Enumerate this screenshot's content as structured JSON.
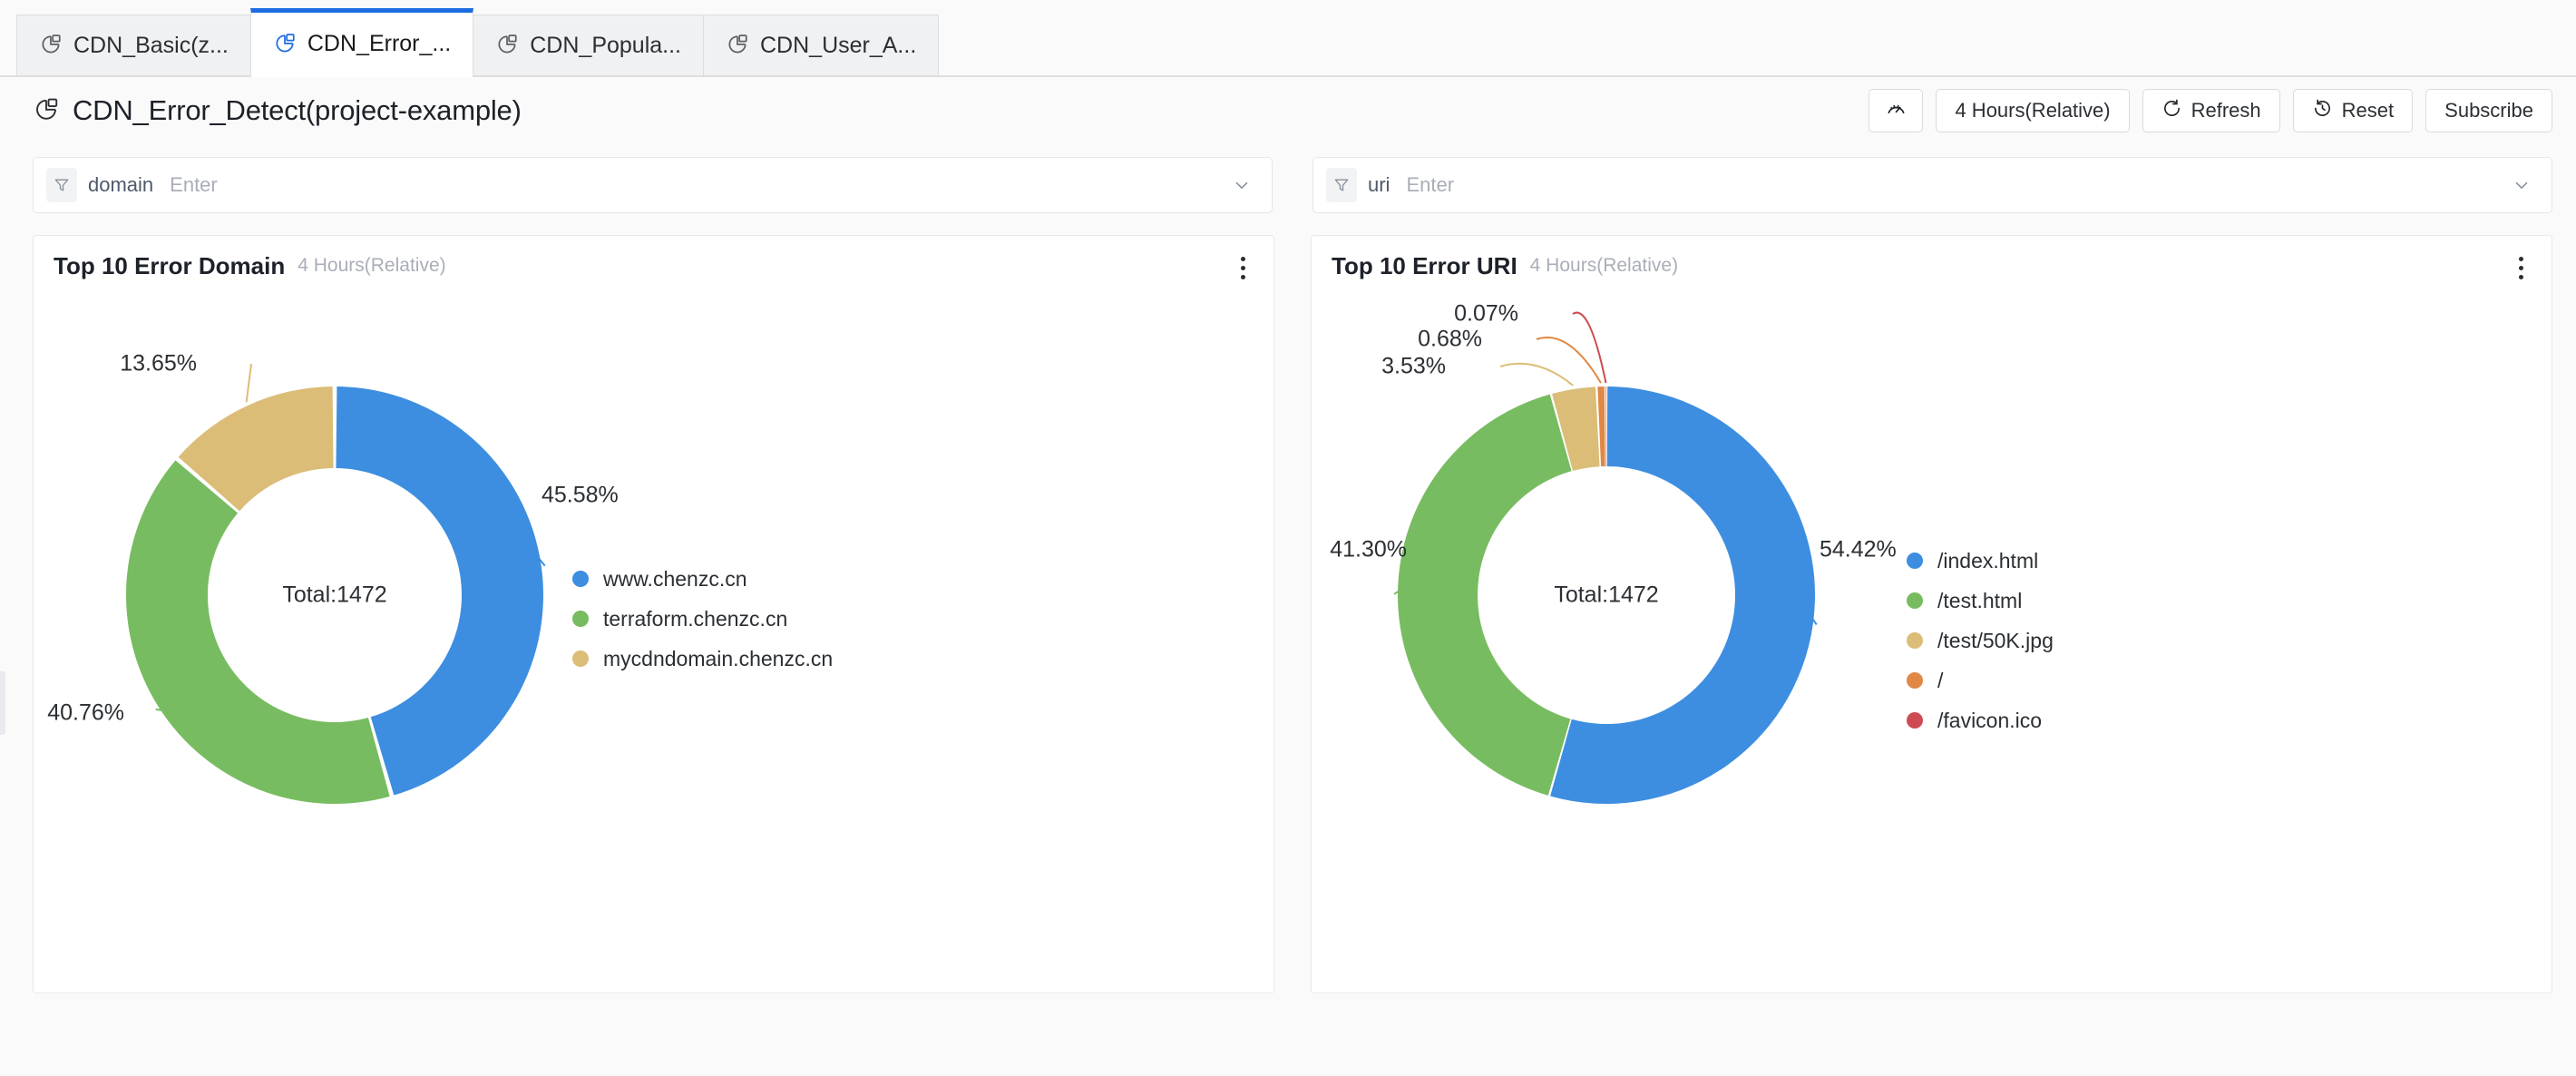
{
  "tabs": [
    {
      "label": "CDN_Basic(z...",
      "icon": "dashboard-icon",
      "active": false
    },
    {
      "label": "CDN_Error_...",
      "icon": "dashboard-icon",
      "active": true
    },
    {
      "label": "CDN_Popula...",
      "icon": "dashboard-icon",
      "active": false
    },
    {
      "label": "CDN_User_A...",
      "icon": "dashboard-icon",
      "active": false
    }
  ],
  "header": {
    "icon": "dashboard-icon",
    "title": "CDN_Error_Detect(project-example)",
    "actions": {
      "gauge_label": "",
      "time_range": "4 Hours(Relative)",
      "refresh": "Refresh",
      "reset": "Reset",
      "subscribe": "Subscribe"
    }
  },
  "filters": [
    {
      "key": "domain",
      "placeholder": "Enter",
      "value": ""
    },
    {
      "key": "uri",
      "placeholder": "Enter",
      "value": ""
    }
  ],
  "colors": {
    "blue": "#3d8ee0",
    "green": "#78bc61",
    "tan": "#dbbd78",
    "orange": "#e08844",
    "red": "#cf4b53",
    "accent": "#1c6ce1",
    "text": "#1d2129",
    "muted": "#a9aeb8"
  },
  "cards": [
    {
      "title": "Top 10 Error Domain",
      "subtitle": "4 Hours(Relative)",
      "total_label": "Total:1472"
    },
    {
      "title": "Top 10 Error URI",
      "subtitle": "4 Hours(Relative)",
      "total_label": "Total:1472"
    }
  ],
  "chart_data": [
    {
      "type": "pie",
      "title": "Top 10 Error Domain",
      "subtitle": "4 Hours(Relative)",
      "total": 1472,
      "total_label": "Total:1472",
      "legend_position": "right",
      "categories": [
        "www.chenzc.cn",
        "terraform.chenzc.cn",
        "mycdndomain.chenzc.cn"
      ],
      "values": [
        45.58,
        40.76,
        13.65
      ],
      "value_labels": [
        "45.58%",
        "40.76%",
        "13.65%"
      ],
      "colors": [
        "#3d8ee0",
        "#78bc61",
        "#dbbd78"
      ]
    },
    {
      "type": "pie",
      "title": "Top 10 Error URI",
      "subtitle": "4 Hours(Relative)",
      "total": 1472,
      "total_label": "Total:1472",
      "legend_position": "right",
      "categories": [
        "/index.html",
        "/test.html",
        "/test/50K.jpg",
        "/",
        "/favicon.ico"
      ],
      "values": [
        54.42,
        41.3,
        3.53,
        0.68,
        0.07
      ],
      "value_labels": [
        "54.42%",
        "41.30%",
        "3.53%",
        "0.68%",
        "0.07%"
      ],
      "colors": [
        "#3d8ee0",
        "#78bc61",
        "#dbbd78",
        "#e08844",
        "#cf4b53"
      ]
    }
  ]
}
